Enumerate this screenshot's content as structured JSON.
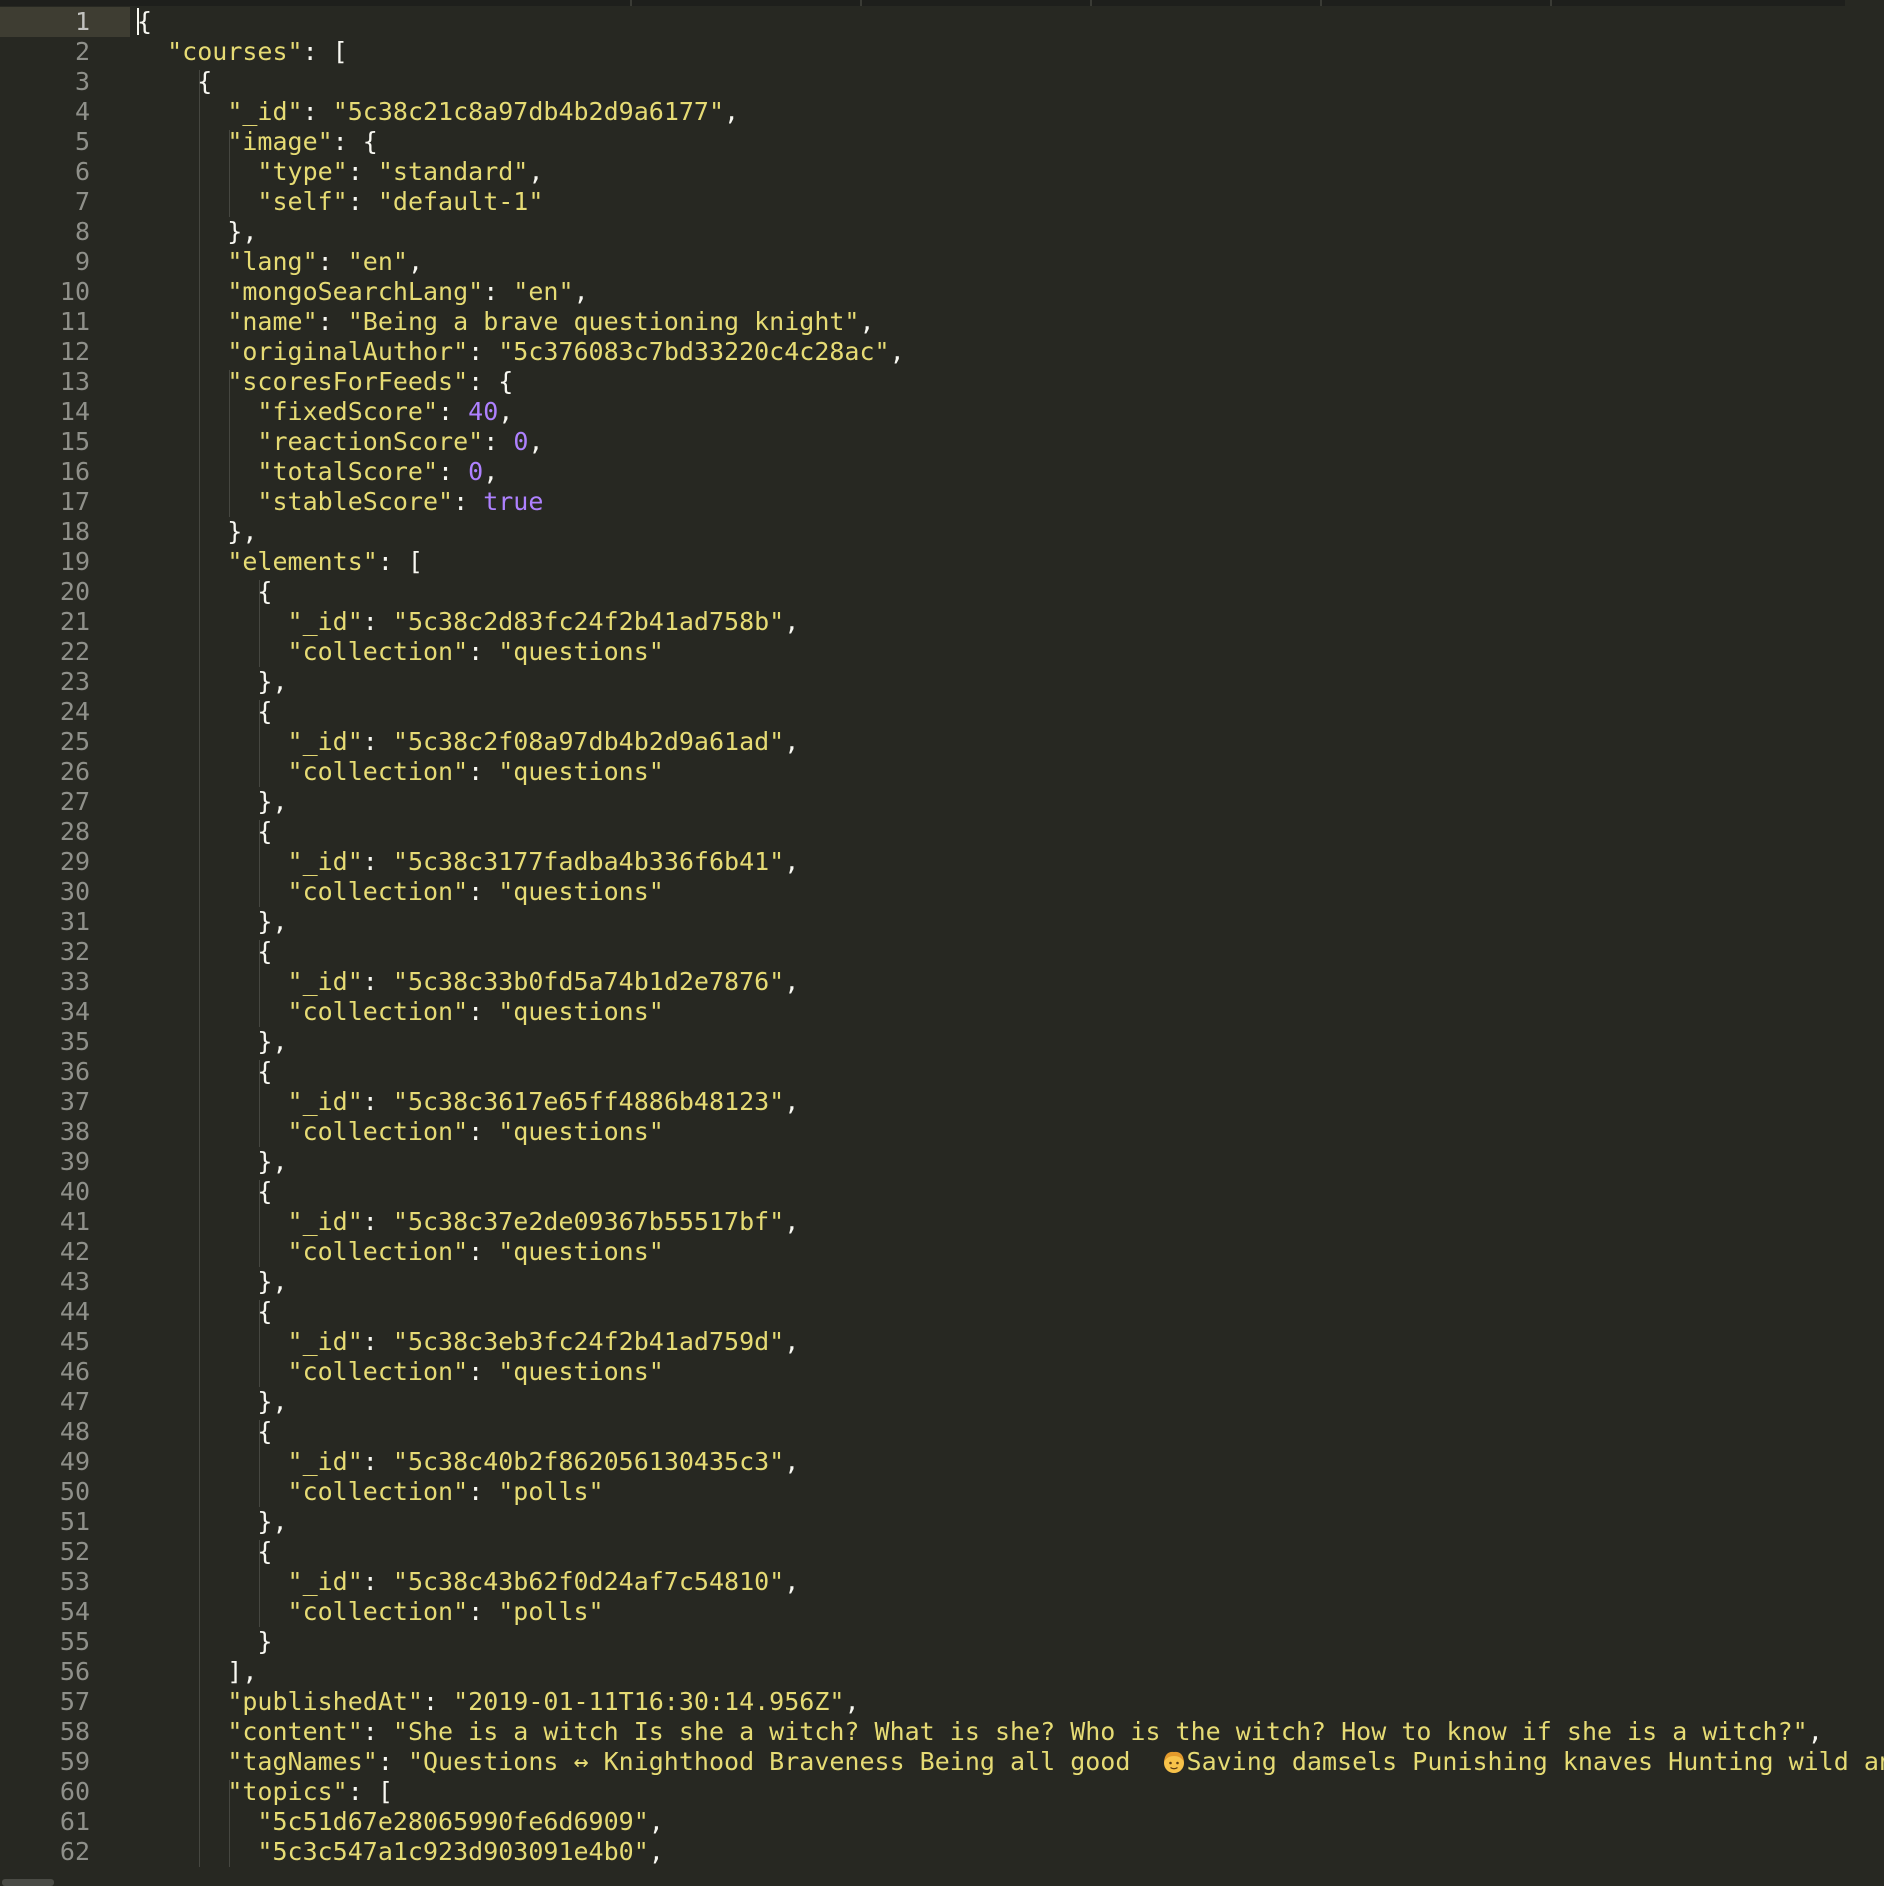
{
  "editor": {
    "language": "json",
    "active_line": 1,
    "lines": [
      [
        [
          "p",
          "{"
        ]
      ],
      [
        [
          "p",
          "  "
        ],
        [
          "k",
          "\"courses\""
        ],
        [
          "p",
          ": ["
        ]
      ],
      [
        [
          "p",
          "    {"
        ]
      ],
      [
        [
          "p",
          "      "
        ],
        [
          "k",
          "\"_id\""
        ],
        [
          "p",
          ": "
        ],
        [
          "s",
          "\"5c38c21c8a97db4b2d9a6177\""
        ],
        [
          "p",
          ","
        ]
      ],
      [
        [
          "p",
          "      "
        ],
        [
          "k",
          "\"image\""
        ],
        [
          "p",
          ": {"
        ]
      ],
      [
        [
          "p",
          "        "
        ],
        [
          "k",
          "\"type\""
        ],
        [
          "p",
          ": "
        ],
        [
          "s",
          "\"standard\""
        ],
        [
          "p",
          ","
        ]
      ],
      [
        [
          "p",
          "        "
        ],
        [
          "k",
          "\"self\""
        ],
        [
          "p",
          ": "
        ],
        [
          "s",
          "\"default-1\""
        ]
      ],
      [
        [
          "p",
          "      },"
        ]
      ],
      [
        [
          "p",
          "      "
        ],
        [
          "k",
          "\"lang\""
        ],
        [
          "p",
          ": "
        ],
        [
          "s",
          "\"en\""
        ],
        [
          "p",
          ","
        ]
      ],
      [
        [
          "p",
          "      "
        ],
        [
          "k",
          "\"mongoSearchLang\""
        ],
        [
          "p",
          ": "
        ],
        [
          "s",
          "\"en\""
        ],
        [
          "p",
          ","
        ]
      ],
      [
        [
          "p",
          "      "
        ],
        [
          "k",
          "\"name\""
        ],
        [
          "p",
          ": "
        ],
        [
          "s",
          "\"Being a brave questioning knight\""
        ],
        [
          "p",
          ","
        ]
      ],
      [
        [
          "p",
          "      "
        ],
        [
          "k",
          "\"originalAuthor\""
        ],
        [
          "p",
          ": "
        ],
        [
          "s",
          "\"5c376083c7bd33220c4c28ac\""
        ],
        [
          "p",
          ","
        ]
      ],
      [
        [
          "p",
          "      "
        ],
        [
          "k",
          "\"scoresForFeeds\""
        ],
        [
          "p",
          ": {"
        ]
      ],
      [
        [
          "p",
          "        "
        ],
        [
          "k",
          "\"fixedScore\""
        ],
        [
          "p",
          ": "
        ],
        [
          "n",
          "40"
        ],
        [
          "p",
          ","
        ]
      ],
      [
        [
          "p",
          "        "
        ],
        [
          "k",
          "\"reactionScore\""
        ],
        [
          "p",
          ": "
        ],
        [
          "n",
          "0"
        ],
        [
          "p",
          ","
        ]
      ],
      [
        [
          "p",
          "        "
        ],
        [
          "k",
          "\"totalScore\""
        ],
        [
          "p",
          ": "
        ],
        [
          "n",
          "0"
        ],
        [
          "p",
          ","
        ]
      ],
      [
        [
          "p",
          "        "
        ],
        [
          "k",
          "\"stableScore\""
        ],
        [
          "p",
          ": "
        ],
        [
          "b",
          "true"
        ]
      ],
      [
        [
          "p",
          "      },"
        ]
      ],
      [
        [
          "p",
          "      "
        ],
        [
          "k",
          "\"elements\""
        ],
        [
          "p",
          ": ["
        ]
      ],
      [
        [
          "p",
          "        {"
        ]
      ],
      [
        [
          "p",
          "          "
        ],
        [
          "k",
          "\"_id\""
        ],
        [
          "p",
          ": "
        ],
        [
          "s",
          "\"5c38c2d83fc24f2b41ad758b\""
        ],
        [
          "p",
          ","
        ]
      ],
      [
        [
          "p",
          "          "
        ],
        [
          "k",
          "\"collection\""
        ],
        [
          "p",
          ": "
        ],
        [
          "s",
          "\"questions\""
        ]
      ],
      [
        [
          "p",
          "        },"
        ]
      ],
      [
        [
          "p",
          "        {"
        ]
      ],
      [
        [
          "p",
          "          "
        ],
        [
          "k",
          "\"_id\""
        ],
        [
          "p",
          ": "
        ],
        [
          "s",
          "\"5c38c2f08a97db4b2d9a61ad\""
        ],
        [
          "p",
          ","
        ]
      ],
      [
        [
          "p",
          "          "
        ],
        [
          "k",
          "\"collection\""
        ],
        [
          "p",
          ": "
        ],
        [
          "s",
          "\"questions\""
        ]
      ],
      [
        [
          "p",
          "        },"
        ]
      ],
      [
        [
          "p",
          "        {"
        ]
      ],
      [
        [
          "p",
          "          "
        ],
        [
          "k",
          "\"_id\""
        ],
        [
          "p",
          ": "
        ],
        [
          "s",
          "\"5c38c3177fadba4b336f6b41\""
        ],
        [
          "p",
          ","
        ]
      ],
      [
        [
          "p",
          "          "
        ],
        [
          "k",
          "\"collection\""
        ],
        [
          "p",
          ": "
        ],
        [
          "s",
          "\"questions\""
        ]
      ],
      [
        [
          "p",
          "        },"
        ]
      ],
      [
        [
          "p",
          "        {"
        ]
      ],
      [
        [
          "p",
          "          "
        ],
        [
          "k",
          "\"_id\""
        ],
        [
          "p",
          ": "
        ],
        [
          "s",
          "\"5c38c33b0fd5a74b1d2e7876\""
        ],
        [
          "p",
          ","
        ]
      ],
      [
        [
          "p",
          "          "
        ],
        [
          "k",
          "\"collection\""
        ],
        [
          "p",
          ": "
        ],
        [
          "s",
          "\"questions\""
        ]
      ],
      [
        [
          "p",
          "        },"
        ]
      ],
      [
        [
          "p",
          "        {"
        ]
      ],
      [
        [
          "p",
          "          "
        ],
        [
          "k",
          "\"_id\""
        ],
        [
          "p",
          ": "
        ],
        [
          "s",
          "\"5c38c3617e65ff4886b48123\""
        ],
        [
          "p",
          ","
        ]
      ],
      [
        [
          "p",
          "          "
        ],
        [
          "k",
          "\"collection\""
        ],
        [
          "p",
          ": "
        ],
        [
          "s",
          "\"questions\""
        ]
      ],
      [
        [
          "p",
          "        },"
        ]
      ],
      [
        [
          "p",
          "        {"
        ]
      ],
      [
        [
          "p",
          "          "
        ],
        [
          "k",
          "\"_id\""
        ],
        [
          "p",
          ": "
        ],
        [
          "s",
          "\"5c38c37e2de09367b55517bf\""
        ],
        [
          "p",
          ","
        ]
      ],
      [
        [
          "p",
          "          "
        ],
        [
          "k",
          "\"collection\""
        ],
        [
          "p",
          ": "
        ],
        [
          "s",
          "\"questions\""
        ]
      ],
      [
        [
          "p",
          "        },"
        ]
      ],
      [
        [
          "p",
          "        {"
        ]
      ],
      [
        [
          "p",
          "          "
        ],
        [
          "k",
          "\"_id\""
        ],
        [
          "p",
          ": "
        ],
        [
          "s",
          "\"5c38c3eb3fc24f2b41ad759d\""
        ],
        [
          "p",
          ","
        ]
      ],
      [
        [
          "p",
          "          "
        ],
        [
          "k",
          "\"collection\""
        ],
        [
          "p",
          ": "
        ],
        [
          "s",
          "\"questions\""
        ]
      ],
      [
        [
          "p",
          "        },"
        ]
      ],
      [
        [
          "p",
          "        {"
        ]
      ],
      [
        [
          "p",
          "          "
        ],
        [
          "k",
          "\"_id\""
        ],
        [
          "p",
          ": "
        ],
        [
          "s",
          "\"5c38c40b2f862056130435c3\""
        ],
        [
          "p",
          ","
        ]
      ],
      [
        [
          "p",
          "          "
        ],
        [
          "k",
          "\"collection\""
        ],
        [
          "p",
          ": "
        ],
        [
          "s",
          "\"polls\""
        ]
      ],
      [
        [
          "p",
          "        },"
        ]
      ],
      [
        [
          "p",
          "        {"
        ]
      ],
      [
        [
          "p",
          "          "
        ],
        [
          "k",
          "\"_id\""
        ],
        [
          "p",
          ": "
        ],
        [
          "s",
          "\"5c38c43b62f0d24af7c54810\""
        ],
        [
          "p",
          ","
        ]
      ],
      [
        [
          "p",
          "          "
        ],
        [
          "k",
          "\"collection\""
        ],
        [
          "p",
          ": "
        ],
        [
          "s",
          "\"polls\""
        ]
      ],
      [
        [
          "p",
          "        }"
        ]
      ],
      [
        [
          "p",
          "      ],"
        ]
      ],
      [
        [
          "p",
          "      "
        ],
        [
          "k",
          "\"publishedAt\""
        ],
        [
          "p",
          ": "
        ],
        [
          "s",
          "\"2019-01-11T16:30:14.956Z\""
        ],
        [
          "p",
          ","
        ]
      ],
      [
        [
          "p",
          "      "
        ],
        [
          "k",
          "\"content\""
        ],
        [
          "p",
          ": "
        ],
        [
          "s",
          "\"She is a witch Is she a witch? What is she? Who is the witch? How to know if she is a witch?\""
        ],
        [
          "p",
          ","
        ]
      ],
      [
        [
          "p",
          "      "
        ],
        [
          "k",
          "\"tagNames\""
        ],
        [
          "p",
          ": "
        ],
        [
          "s",
          "\"Questions ↔ Knighthood Braveness Being all good  "
        ],
        [
          "emoji",
          "woman-icon"
        ],
        [
          "s",
          "Saving damsels Punishing knaves Hunting wild animals\""
        ],
        [
          "p",
          ","
        ]
      ],
      [
        [
          "p",
          "      "
        ],
        [
          "k",
          "\"topics\""
        ],
        [
          "p",
          ": ["
        ]
      ],
      [
        [
          "p",
          "        "
        ],
        [
          "s",
          "\"5c51d67e28065990fe6d6909\""
        ],
        [
          "p",
          ","
        ]
      ],
      [
        [
          "p",
          "        "
        ],
        [
          "s",
          "\"5c3c547a1c923d903091e4b0\""
        ],
        [
          "p",
          ","
        ]
      ]
    ]
  },
  "theme": {
    "background": "#272822",
    "key_color": "#e6db74",
    "string_color": "#e6db74",
    "number_color": "#ae81ff",
    "punct_color": "#f8f8f2",
    "gutter_color": "#8f908a",
    "active_line_color": "#3e3d32"
  }
}
